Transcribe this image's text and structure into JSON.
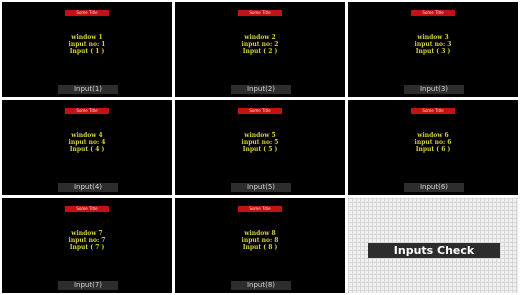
{
  "windows": [
    {
      "topbar": "Some Title",
      "line1": "window 1",
      "line2": "input no: 1",
      "line3": "Input ( 1 )",
      "input_label": "Input(1)"
    },
    {
      "topbar": "Some Title",
      "line1": "window 2",
      "line2": "input no: 2",
      "line3": "Input ( 2 )",
      "input_label": "Input(2)"
    },
    {
      "topbar": "Some Title",
      "line1": "window 3",
      "line2": "input no: 3",
      "line3": "Input ( 3 )",
      "input_label": "Input(3)"
    },
    {
      "topbar": "Some Title",
      "line1": "window 4",
      "line2": "input no: 4",
      "line3": "Input ( 4 )",
      "input_label": "Input(4)"
    },
    {
      "topbar": "Some Title",
      "line1": "window 5",
      "line2": "input no: 5",
      "line3": "Input ( 5 )",
      "input_label": "Input(5)"
    },
    {
      "topbar": "Some Title",
      "line1": "window 6",
      "line2": "input no: 6",
      "line3": "Input ( 6 )",
      "input_label": "Input(6)"
    },
    {
      "topbar": "Some Title",
      "line1": "window 7",
      "line2": "input no: 7",
      "line3": "Input ( 7 )",
      "input_label": "Input(7)"
    },
    {
      "topbar": "Some Title",
      "line1": "window 8",
      "line2": "input no: 8",
      "line3": "Input ( 8 )",
      "input_label": "Input(8)"
    }
  ],
  "check": {
    "label": "Inputs Check"
  }
}
